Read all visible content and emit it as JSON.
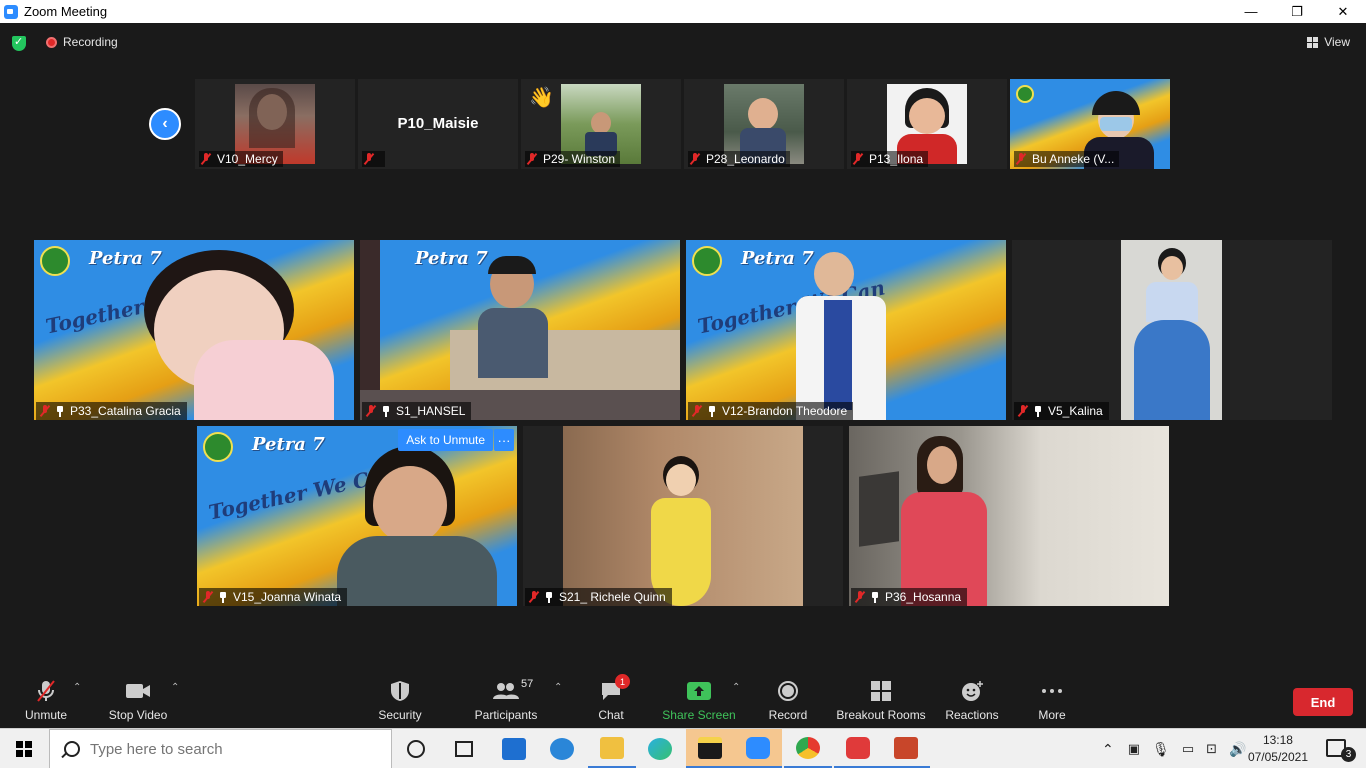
{
  "window": {
    "title": "Zoom Meeting",
    "minimize": "—",
    "restore": "❐",
    "close": "✕"
  },
  "meeting_bar": {
    "recording": "Recording",
    "view": "View"
  },
  "thumbnails": [
    {
      "name": "V10_Mercy"
    },
    {
      "name": "P10_Maisie",
      "display_name": "P10_Maisie"
    },
    {
      "name": "P29- Winston"
    },
    {
      "name": "P28_Leonardo"
    },
    {
      "name": "P13_Ilona"
    },
    {
      "name": "Bu Anneke (V..."
    }
  ],
  "tiles": [
    {
      "name": "P33_Catalina Gracia"
    },
    {
      "name": "S1_HANSEL"
    },
    {
      "name": "V12-Brandon Theodore"
    },
    {
      "name": "V5_Kalina"
    },
    {
      "name": "V15_Joanna Winata"
    },
    {
      "name": "S21_ Richele Quinn"
    },
    {
      "name": "P36_Hosanna"
    }
  ],
  "banner_text": {
    "petra": "Petra 7",
    "together": "Together We Can"
  },
  "hover": {
    "ask_to_unmute": "Ask to Unmute",
    "more": "···"
  },
  "toolbar": {
    "unmute": "Unmute",
    "stop_video": "Stop Video",
    "security": "Security",
    "participants": "Participants",
    "participants_count": "57",
    "chat": "Chat",
    "chat_badge": "1",
    "share_screen": "Share Screen",
    "record": "Record",
    "breakout_rooms": "Breakout Rooms",
    "reactions": "Reactions",
    "more": "More",
    "end": "End"
  },
  "taskbar": {
    "search_placeholder": "Type here to search",
    "time": "13:18",
    "date": "07/05/2021",
    "notifications": "3"
  },
  "colors": {
    "zoom_blue": "#2d8cff",
    "end_red": "#d8282e",
    "share_green": "#3fc35a",
    "muted_red": "#e02828"
  }
}
